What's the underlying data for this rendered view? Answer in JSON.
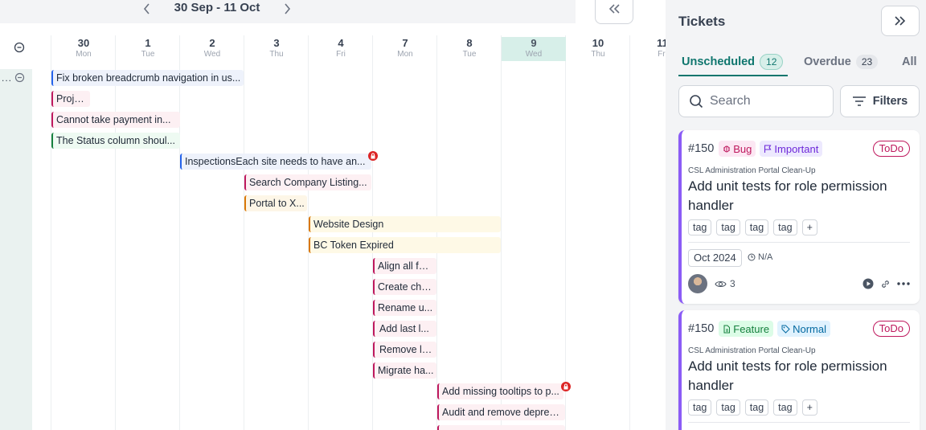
{
  "calendar": {
    "date_range": "30 Sep - 11 Oct",
    "days": [
      {
        "num": "30",
        "wd": "Mon"
      },
      {
        "num": "1",
        "wd": "Tue"
      },
      {
        "num": "2",
        "wd": "Wed"
      },
      {
        "num": "3",
        "wd": "Thu"
      },
      {
        "num": "4",
        "wd": "Fri"
      },
      {
        "num": "7",
        "wd": "Mon"
      },
      {
        "num": "8",
        "wd": "Tue"
      },
      {
        "num": "9",
        "wd": "Wed"
      },
      {
        "num": "10",
        "wd": "Thu"
      },
      {
        "num": "11",
        "wd": "Fri"
      }
    ],
    "today_index": 7,
    "row_dots": "...",
    "events": [
      "Fix broken breadcrumb navigation in us...",
      "Proje...",
      "Cannot take payment in...",
      "The Status column shoul...",
      "InspectionsEach site needs to have an...",
      "Search Company Listing...",
      "Portal to X...",
      "Website Design",
      "BC Token Expired",
      "Align all for...",
      "Create cha...",
      "Rename u...",
      "Add last l...",
      "Remove le...",
      "Migrate ha...",
      "Add missing tooltips to p...",
      "Audit and remove deprec..."
    ]
  },
  "panel": {
    "title": "Tickets",
    "tabs": [
      {
        "label": "Unscheduled",
        "count": "12"
      },
      {
        "label": "Overdue",
        "count": "23"
      },
      {
        "label": "All"
      }
    ],
    "search_placeholder": "Search",
    "filters_label": "Filters",
    "cards": [
      {
        "id": "#150",
        "type_label": "Bug",
        "priority_label": "Important",
        "status": "ToDo",
        "project": "CSL Administration Portal Clean-Up",
        "title": "Add unit tests for role permission handler",
        "tags": [
          "tag",
          "tag",
          "tag",
          "tag"
        ],
        "add_tag": "+",
        "date": "Oct 2024",
        "due": "N/A",
        "views": "3"
      },
      {
        "id": "#150",
        "type_label": "Feature",
        "priority_label": "Normal",
        "status": "ToDo",
        "project": "CSL Administration Portal Clean-Up",
        "title": "Add unit tests for role permission handler",
        "tags": [
          "tag",
          "tag",
          "tag",
          "tag"
        ],
        "add_tag": "+"
      }
    ]
  },
  "colors": {
    "accent": "#0f766e",
    "today_bg": "#d7efe9",
    "card_border": "#8b5cf6",
    "status_todo": "#be185d"
  }
}
